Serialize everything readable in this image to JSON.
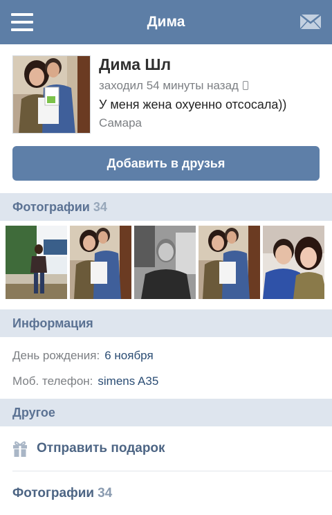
{
  "header": {
    "title": "Дима",
    "menu_icon": "hamburger-menu-icon",
    "mail_icon": "envelope-icon"
  },
  "profile": {
    "name": "Дима Шл",
    "last_seen": "заходил 54 минуты назад",
    "device_icon": "mobile-phone-icon",
    "status": "У меня жена охуенно отсосала))",
    "city": "Самара"
  },
  "actions": {
    "add_friend": "Добавить в друзья"
  },
  "photos_section": {
    "title": "Фотографии",
    "count": "34"
  },
  "info_section": {
    "title": "Информация",
    "rows": [
      {
        "label": "День рождения:",
        "value": "6 ноября"
      },
      {
        "label": "Моб. телефон:",
        "value": "simens A35"
      }
    ]
  },
  "other_section": {
    "title": "Другое",
    "gift_icon": "gift-icon",
    "gift_label": "Отправить подарок",
    "photos_label": "Фотографии",
    "photos_count": "34"
  },
  "colors": {
    "header_bg": "#5d7ea6",
    "button_bg": "#5e7fa8",
    "section_bg": "#dee5ee",
    "section_text": "#5b7293",
    "link_text": "#2b4d74"
  }
}
